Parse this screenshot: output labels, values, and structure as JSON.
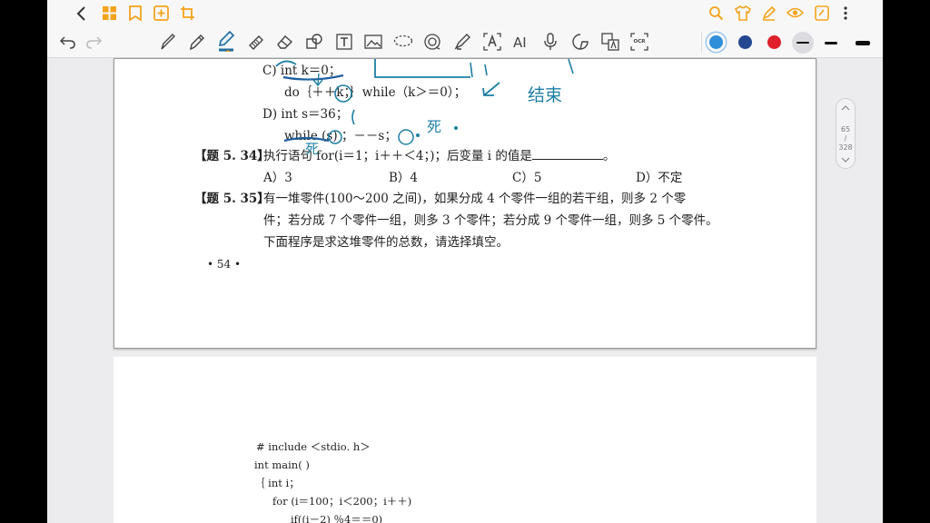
{
  "toolbar": {
    "icons": [
      "back-icon",
      "grid-icon",
      "bookmark-icon",
      "add-page-icon",
      "crop-icon",
      "search-icon",
      "shirt-icon",
      "highlighter-icon",
      "eye-icon",
      "note-icon",
      "more-icon"
    ],
    "tools": [
      "undo-icon",
      "redo-icon",
      "pen-icon",
      "pencil-icon",
      "fountain-pen-icon",
      "eraser-strip-icon",
      "eraser-icon",
      "shape-icon",
      "text-icon",
      "image-icon",
      "lasso-icon",
      "sticker-icon",
      "brush-icon",
      "text-recognize-icon",
      "ai-icon",
      "mic-icon",
      "sticky-icon",
      "translate-icon",
      "ocr-icon"
    ],
    "ai_label": "AI",
    "ocr_label": "OCR",
    "colors": [
      "#2f8fd8",
      "#24478f",
      "#e0202a"
    ],
    "selected_color": "#2f8fd8"
  },
  "page1": {
    "option_c_label": "C) int k＝0；",
    "option_c_do": "do｛＋＋k；｝while（k＞＝0）；",
    "option_d_label": "D) int s＝36；",
    "option_d_while": "while (s) ；－－s；",
    "q534_num": "【题 5. 34】",
    "q534_text": "执行语句 for(i＝1；i＋＋＜4；)；后变量 i 的值是",
    "q534_end": "。",
    "q534_options": [
      "A）3",
      "B）4",
      "C）5",
      "D）不定"
    ],
    "q535_num": "【题 5. 35】",
    "q535_lines": [
      "有一堆零件(100～200 之间)，如果分成 4 个零件一组的若干组，则多 2 个零",
      "件；若分成 7 个零件一组，则多 3 个零件；若分成 9 个零件一组，则多 5 个零件。",
      "下面程序是求这堆零件的总数，请选择填空。"
    ],
    "page_number": "• 54 •",
    "handwriting": [
      "死",
      "结束",
      "死"
    ]
  },
  "page2": {
    "code": [
      "# include ＜stdio. h＞",
      "int main( )",
      "｛   int i；",
      "for (i＝100；i＜200；i＋＋)",
      "if((i－2) ％4＝＝0)"
    ]
  },
  "scroll": {
    "current": "65",
    "slash": "/",
    "total": "328"
  }
}
